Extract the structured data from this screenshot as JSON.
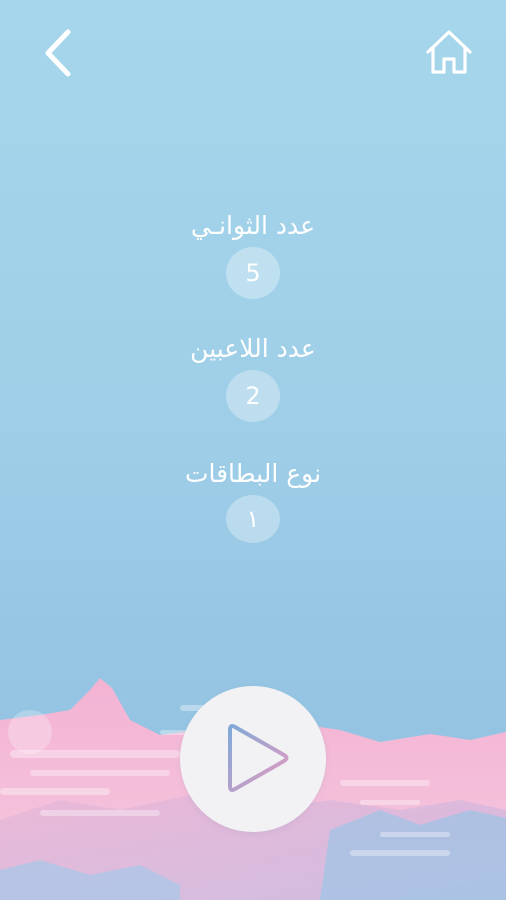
{
  "header": {
    "back_icon": "chevron-left-icon",
    "home_icon": "home-icon"
  },
  "settings": {
    "seconds": {
      "label": "عدد الثوانـي",
      "value": "5"
    },
    "players": {
      "label": "عدد اللاعبين",
      "value": "2"
    },
    "card_type": {
      "label": "نوع البطاقات",
      "value": "١"
    }
  },
  "play": {
    "icon": "play-icon"
  },
  "colors": {
    "sky": "#a6d6eb",
    "mountain_pink": "#f0b7d6",
    "play_triangle_start": "#7fa9d8",
    "play_triangle_end": "#e79ac0"
  }
}
